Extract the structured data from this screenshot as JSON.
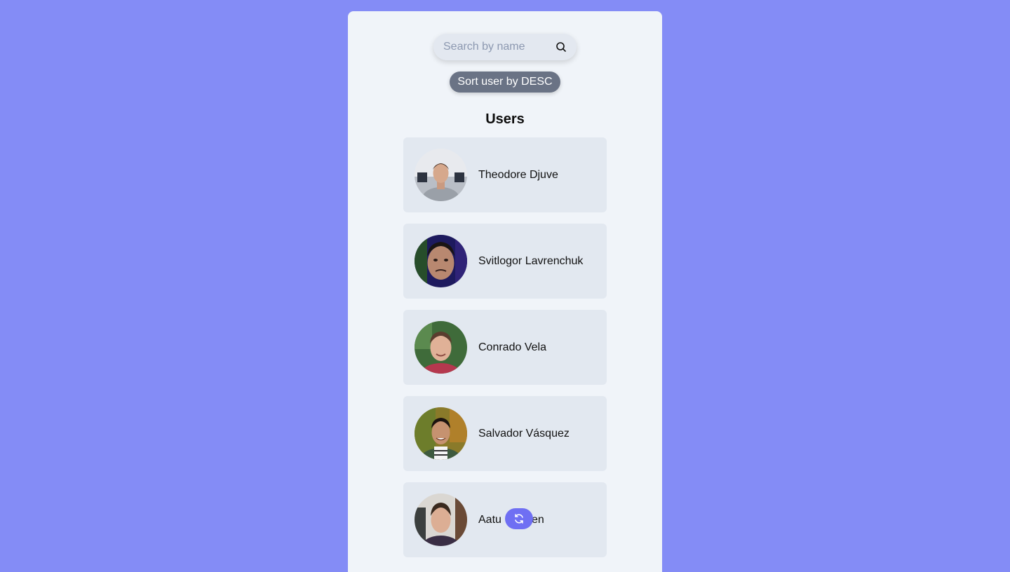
{
  "search": {
    "placeholder": "Search by name",
    "value": ""
  },
  "sort_button": {
    "label": "Sort user by DESC"
  },
  "title": "Users",
  "users": [
    {
      "name": "Theodore Djuve",
      "avatar": "user-photo"
    },
    {
      "name": "Svitlogor Lavrenchuk",
      "avatar": "user-photo"
    },
    {
      "name": "Conrado Vela",
      "avatar": "user-photo"
    },
    {
      "name": "Salvador Vásquez",
      "avatar": "user-photo"
    },
    {
      "name": "Aatu Niemi-ben",
      "avatar": "user-photo",
      "name_partial_visible": "Aatu ... en"
    }
  ],
  "fab": {
    "icon": "refresh-icon"
  },
  "colors": {
    "background": "#848cf6",
    "panel": "#f0f4f9",
    "card": "#e2e8f0",
    "sort_button": "#6a7385",
    "fab": "#6f6ff3"
  }
}
